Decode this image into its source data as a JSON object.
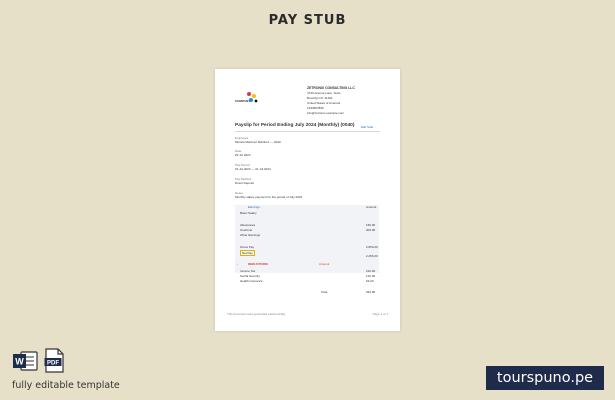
{
  "title": "PAY STUB",
  "tagline": "fully editable template",
  "brand": "tourspuno.pe",
  "icons": {
    "word": "word-icon",
    "pdf": "pdf-icon"
  },
  "colors": {
    "background": "#e7e0c9",
    "brand": "#1e2b4a",
    "accent": "#2b67c6"
  },
  "document": {
    "logo_label": "COMPANY",
    "company": {
      "name": "ZETRONIX CONSULTING LLC",
      "address1": "4740 Avenue Lane, Suite",
      "address2": "Brooklyn NY 11201",
      "address3": "United States of America",
      "phone": "1234567890",
      "email": "info@zetronix.example.com"
    },
    "payslip_heading": "Payslip for Period Ending July 2024 (Monthly) (0040)",
    "edit_link": "Edit Stub",
    "employee_label": "Employee",
    "employee_value": "Monica Martinez Martinez — 0040",
    "pay_date_label": "Date",
    "pay_date_value": "29 Jul 2024",
    "period_label": "Pay Period",
    "period_value": "01 Jul 2024 — 31 Jul 2024",
    "method_label": "Pay Method",
    "method_value": "Direct Deposit",
    "notes_label": "Notes",
    "notes_value": "Monthly salary payment for the period of July 2024",
    "earnings_heading": "Earnings",
    "earnings_amount_head": "Amount",
    "earnings_item": "Basic Salary",
    "earnings_rows": [
      {
        "label": "Allowances",
        "value": "150.00"
      },
      {
        "label": "Overtime",
        "value": "300.00"
      },
      {
        "label": "Other Earnings",
        "value": ""
      }
    ],
    "gross_label": "Gross Pay",
    "gross_value": "2,850.00",
    "net_label": "Net Pay",
    "net_value": "2,456.00",
    "deductions_heading": "DEDUCTIONS",
    "deductions_note": "Amount",
    "deduction_rows": [
      {
        "label": "Income Tax",
        "value": "210.00"
      },
      {
        "label": "Social Security",
        "value": "120.00"
      },
      {
        "label": "Health Insurance",
        "value": "64.00"
      }
    ],
    "total_label": "Total",
    "total_value": "394.00",
    "footer_left": "This document was generated electronically",
    "footer_right": "Page 1 of 1"
  }
}
